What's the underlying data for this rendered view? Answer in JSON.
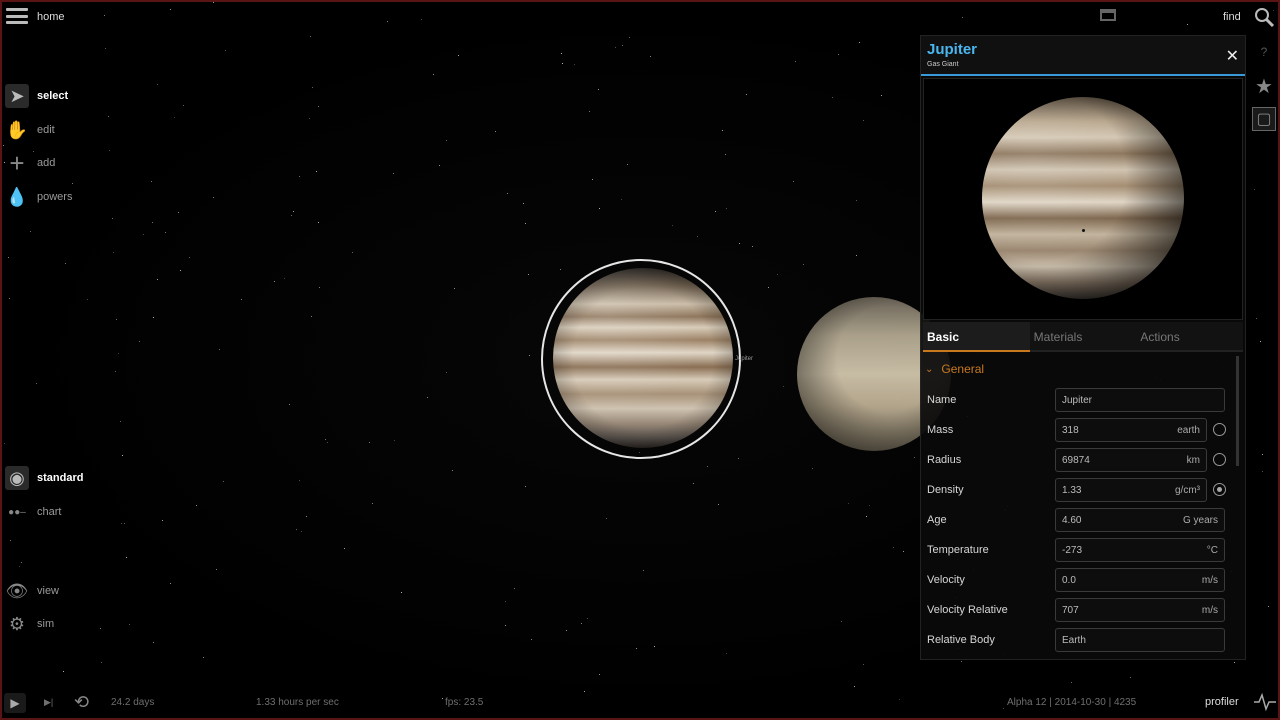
{
  "topbar": {
    "home_label": "home",
    "find_label": "find"
  },
  "left_menu": {
    "items": [
      {
        "label": "select",
        "icon": "cursor-icon"
      },
      {
        "label": "edit",
        "icon": "hand-icon"
      },
      {
        "label": "add",
        "icon": "plus-icon"
      },
      {
        "label": "powers",
        "icon": "drop-icon"
      }
    ],
    "view_modes": [
      {
        "label": "standard",
        "icon": "eye-circle-icon"
      },
      {
        "label": "chart",
        "icon": "chart-dots-icon"
      }
    ],
    "bottom_items": [
      {
        "label": "view",
        "icon": "eye-icon"
      },
      {
        "label": "sim",
        "icon": "gear-icon"
      }
    ]
  },
  "scene": {
    "selected_label": "Jupiter"
  },
  "panel": {
    "title": "Jupiter",
    "subtitle": "Gas Giant",
    "tabs": [
      "Basic",
      "Materials",
      "Actions"
    ],
    "active_tab": "Basic",
    "section_label": "General",
    "properties": [
      {
        "label": "Name",
        "value": "Jupiter",
        "unit": ""
      },
      {
        "label": "Mass",
        "value": "318",
        "unit": "earth"
      },
      {
        "label": "Radius",
        "value": "69874",
        "unit": "km"
      },
      {
        "label": "Density",
        "value": "1.33",
        "unit": "g/cm³"
      },
      {
        "label": "Age",
        "value": "4.60",
        "unit": "G years"
      },
      {
        "label": "Temperature",
        "value": "-273",
        "unit": "°C"
      },
      {
        "label": "Velocity",
        "value": "0.0",
        "unit": "m/s"
      },
      {
        "label": "Velocity Relative",
        "value": "707",
        "unit": "m/s"
      },
      {
        "label": "Relative Body",
        "value": "Earth",
        "unit": ""
      }
    ],
    "radio_selected": "Density"
  },
  "bottom_bar": {
    "elapsed": "24.2 days",
    "rate": "1.33 hours per sec",
    "fps": "fps: 23.5",
    "version": "Alpha 12  |  2014-10-30  |  4235",
    "profiler_label": "profiler"
  },
  "colors": {
    "accent_blue": "#4ab6f0",
    "accent_orange": "#c8791e",
    "frame": "#5a1414"
  }
}
